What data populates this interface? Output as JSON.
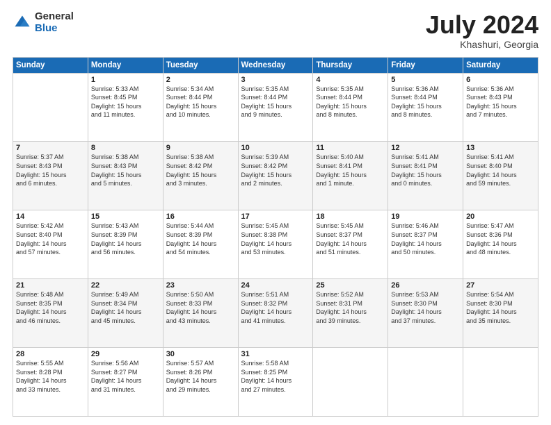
{
  "logo": {
    "general": "General",
    "blue": "Blue"
  },
  "title": "July 2024",
  "location": "Khashuri, Georgia",
  "weekdays": [
    "Sunday",
    "Monday",
    "Tuesday",
    "Wednesday",
    "Thursday",
    "Friday",
    "Saturday"
  ],
  "weeks": [
    [
      {
        "day": "",
        "info": ""
      },
      {
        "day": "1",
        "info": "Sunrise: 5:33 AM\nSunset: 8:45 PM\nDaylight: 15 hours\nand 11 minutes."
      },
      {
        "day": "2",
        "info": "Sunrise: 5:34 AM\nSunset: 8:44 PM\nDaylight: 15 hours\nand 10 minutes."
      },
      {
        "day": "3",
        "info": "Sunrise: 5:35 AM\nSunset: 8:44 PM\nDaylight: 15 hours\nand 9 minutes."
      },
      {
        "day": "4",
        "info": "Sunrise: 5:35 AM\nSunset: 8:44 PM\nDaylight: 15 hours\nand 8 minutes."
      },
      {
        "day": "5",
        "info": "Sunrise: 5:36 AM\nSunset: 8:44 PM\nDaylight: 15 hours\nand 8 minutes."
      },
      {
        "day": "6",
        "info": "Sunrise: 5:36 AM\nSunset: 8:43 PM\nDaylight: 15 hours\nand 7 minutes."
      }
    ],
    [
      {
        "day": "7",
        "info": "Sunrise: 5:37 AM\nSunset: 8:43 PM\nDaylight: 15 hours\nand 6 minutes."
      },
      {
        "day": "8",
        "info": "Sunrise: 5:38 AM\nSunset: 8:43 PM\nDaylight: 15 hours\nand 5 minutes."
      },
      {
        "day": "9",
        "info": "Sunrise: 5:38 AM\nSunset: 8:42 PM\nDaylight: 15 hours\nand 3 minutes."
      },
      {
        "day": "10",
        "info": "Sunrise: 5:39 AM\nSunset: 8:42 PM\nDaylight: 15 hours\nand 2 minutes."
      },
      {
        "day": "11",
        "info": "Sunrise: 5:40 AM\nSunset: 8:41 PM\nDaylight: 15 hours\nand 1 minute."
      },
      {
        "day": "12",
        "info": "Sunrise: 5:41 AM\nSunset: 8:41 PM\nDaylight: 15 hours\nand 0 minutes."
      },
      {
        "day": "13",
        "info": "Sunrise: 5:41 AM\nSunset: 8:40 PM\nDaylight: 14 hours\nand 59 minutes."
      }
    ],
    [
      {
        "day": "14",
        "info": "Sunrise: 5:42 AM\nSunset: 8:40 PM\nDaylight: 14 hours\nand 57 minutes."
      },
      {
        "day": "15",
        "info": "Sunrise: 5:43 AM\nSunset: 8:39 PM\nDaylight: 14 hours\nand 56 minutes."
      },
      {
        "day": "16",
        "info": "Sunrise: 5:44 AM\nSunset: 8:39 PM\nDaylight: 14 hours\nand 54 minutes."
      },
      {
        "day": "17",
        "info": "Sunrise: 5:45 AM\nSunset: 8:38 PM\nDaylight: 14 hours\nand 53 minutes."
      },
      {
        "day": "18",
        "info": "Sunrise: 5:45 AM\nSunset: 8:37 PM\nDaylight: 14 hours\nand 51 minutes."
      },
      {
        "day": "19",
        "info": "Sunrise: 5:46 AM\nSunset: 8:37 PM\nDaylight: 14 hours\nand 50 minutes."
      },
      {
        "day": "20",
        "info": "Sunrise: 5:47 AM\nSunset: 8:36 PM\nDaylight: 14 hours\nand 48 minutes."
      }
    ],
    [
      {
        "day": "21",
        "info": "Sunrise: 5:48 AM\nSunset: 8:35 PM\nDaylight: 14 hours\nand 46 minutes."
      },
      {
        "day": "22",
        "info": "Sunrise: 5:49 AM\nSunset: 8:34 PM\nDaylight: 14 hours\nand 45 minutes."
      },
      {
        "day": "23",
        "info": "Sunrise: 5:50 AM\nSunset: 8:33 PM\nDaylight: 14 hours\nand 43 minutes."
      },
      {
        "day": "24",
        "info": "Sunrise: 5:51 AM\nSunset: 8:32 PM\nDaylight: 14 hours\nand 41 minutes."
      },
      {
        "day": "25",
        "info": "Sunrise: 5:52 AM\nSunset: 8:31 PM\nDaylight: 14 hours\nand 39 minutes."
      },
      {
        "day": "26",
        "info": "Sunrise: 5:53 AM\nSunset: 8:30 PM\nDaylight: 14 hours\nand 37 minutes."
      },
      {
        "day": "27",
        "info": "Sunrise: 5:54 AM\nSunset: 8:30 PM\nDaylight: 14 hours\nand 35 minutes."
      }
    ],
    [
      {
        "day": "28",
        "info": "Sunrise: 5:55 AM\nSunset: 8:28 PM\nDaylight: 14 hours\nand 33 minutes."
      },
      {
        "day": "29",
        "info": "Sunrise: 5:56 AM\nSunset: 8:27 PM\nDaylight: 14 hours\nand 31 minutes."
      },
      {
        "day": "30",
        "info": "Sunrise: 5:57 AM\nSunset: 8:26 PM\nDaylight: 14 hours\nand 29 minutes."
      },
      {
        "day": "31",
        "info": "Sunrise: 5:58 AM\nSunset: 8:25 PM\nDaylight: 14 hours\nand 27 minutes."
      },
      {
        "day": "",
        "info": ""
      },
      {
        "day": "",
        "info": ""
      },
      {
        "day": "",
        "info": ""
      }
    ]
  ]
}
